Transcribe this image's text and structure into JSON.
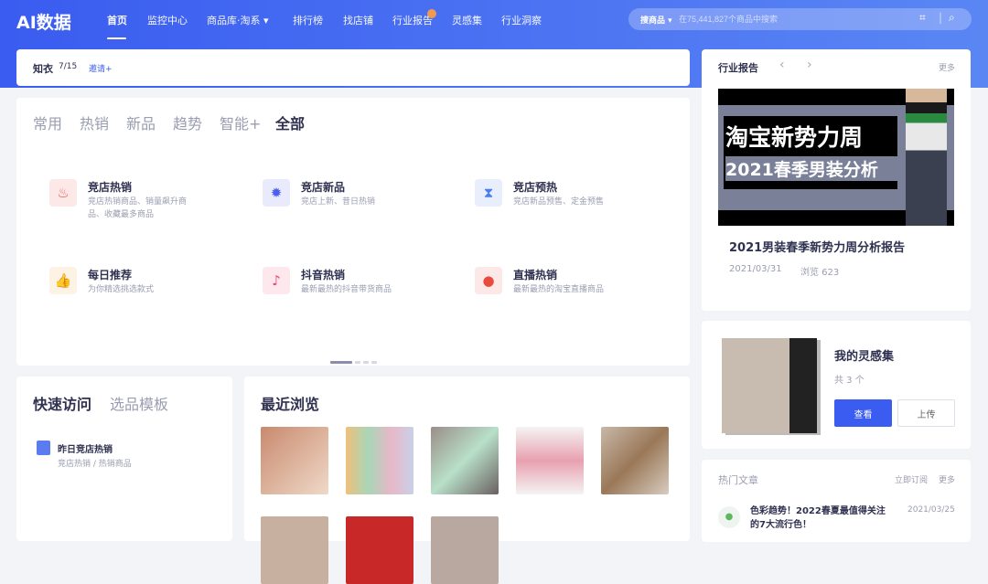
{
  "header": {
    "logo": "AI数据",
    "nav": [
      "首页",
      "监控中心",
      "商品库·淘系 ▾",
      "排行榜",
      "找店铺",
      "行业报告",
      "灵感集",
      "行业洞察"
    ],
    "search": {
      "scope": "搜商品 ▾",
      "placeholder": "在75,441,827个商品中搜索"
    }
  },
  "account": {
    "name": "知衣",
    "quota": "7/15",
    "invite": "邀请+"
  },
  "features": {
    "tabs": [
      "常用",
      "热销",
      "新品",
      "趋势",
      "智能+",
      "全部"
    ],
    "items": [
      {
        "title": "竞店热销",
        "desc": "竞店热销商品、销量飙升商品、收藏最多商品",
        "icon": "fire-icon"
      },
      {
        "title": "竞店新品",
        "desc": "竞店上新、昔日热销",
        "icon": "new-badge-icon"
      },
      {
        "title": "竞店预热",
        "desc": "竞店新品预售、定金预售",
        "icon": "hourglass-icon"
      },
      {
        "title": "每日推荐",
        "desc": "为你精选挑选款式",
        "icon": "thumbs-up-icon"
      },
      {
        "title": "抖音热销",
        "desc": "最新最热的抖音带货商品",
        "icon": "douyin-icon"
      },
      {
        "title": "直播热销",
        "desc": "最新最热的淘宝直播商品",
        "icon": "live-icon"
      }
    ]
  },
  "quick": {
    "tabs": [
      "快速访问",
      "选品模板"
    ],
    "item": {
      "title": "昨日竞店热销",
      "path": "竞店热销 / 热销商品"
    }
  },
  "recent": {
    "title": "最近浏览"
  },
  "report": {
    "title": "行业报告",
    "more": "更多",
    "banner_line1": "淘宝新势力周",
    "banner_line2": "2021春季男装分析",
    "name": "2021男装春季新势力周分析报告",
    "date": "2021/03/31",
    "views": "浏览 623"
  },
  "inspiration": {
    "title": "我的灵感集",
    "count": "共 3 个",
    "view": "查看",
    "upload": "上传"
  },
  "articles": {
    "title": "热门文章",
    "subscribe": "立即订阅",
    "more": "更多",
    "items": [
      {
        "title": "色彩趋势！2022春夏最值得关注的7大流行色！",
        "date": "2021/03/25"
      }
    ]
  },
  "colors": {
    "primary": "#3a5cf0"
  }
}
